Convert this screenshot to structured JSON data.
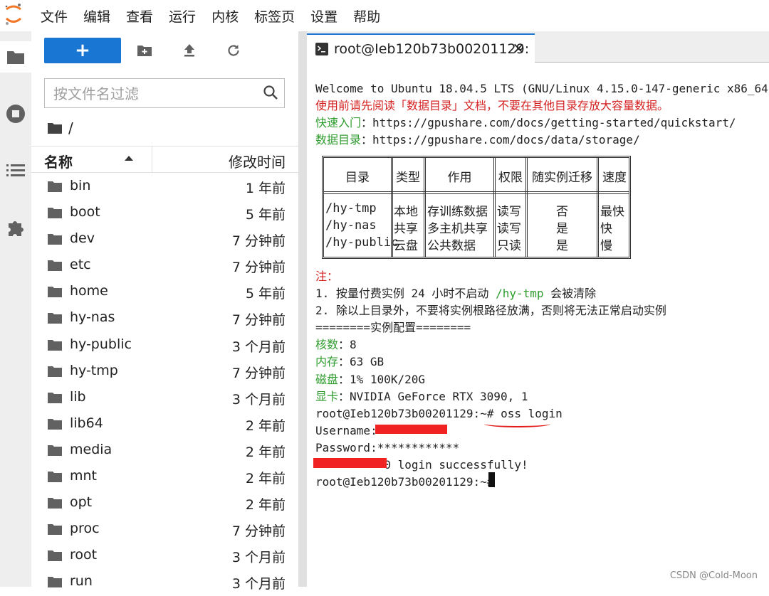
{
  "menu": [
    "文件",
    "编辑",
    "查看",
    "运行",
    "内核",
    "标签页",
    "设置",
    "帮助"
  ],
  "filebrowser": {
    "new_label": "+",
    "filter_placeholder": "按文件名过滤",
    "breadcrumb": "/",
    "col_name": "名称",
    "col_modified": "修改时间",
    "files": [
      {
        "name": "bin",
        "modified": "1 年前"
      },
      {
        "name": "boot",
        "modified": "5 年前"
      },
      {
        "name": "dev",
        "modified": "7 分钟前"
      },
      {
        "name": "etc",
        "modified": "7 分钟前"
      },
      {
        "name": "home",
        "modified": "5 年前"
      },
      {
        "name": "hy-nas",
        "modified": "7 分钟前"
      },
      {
        "name": "hy-public",
        "modified": "3 个月前"
      },
      {
        "name": "hy-tmp",
        "modified": "7 分钟前"
      },
      {
        "name": "lib",
        "modified": "3 个月前"
      },
      {
        "name": "lib64",
        "modified": "2 年前"
      },
      {
        "name": "media",
        "modified": "2 年前"
      },
      {
        "name": "mnt",
        "modified": "2 年前"
      },
      {
        "name": "opt",
        "modified": "2 年前"
      },
      {
        "name": "proc",
        "modified": "7 分钟前"
      },
      {
        "name": "root",
        "modified": "3 个月前"
      },
      {
        "name": "run",
        "modified": "3 个月前"
      }
    ]
  },
  "terminal": {
    "tab_title": "root@Ieb120b73b00201129:",
    "close": "×",
    "welcome": "Welcome to Ubuntu 18.04.5 LTS (GNU/Linux 4.15.0-147-generic x86_64)",
    "notice": "使用前请先阅读「数据目录」文档，不要在其他目录存放大容量数据。",
    "quick_label": "快速入门",
    "quick_url": "：https://gpushare.com/docs/getting-started/quickstart/",
    "data_label": "数据目录",
    "data_url": "：https://gpushare.com/docs/data/storage/",
    "table": {
      "headers": [
        "目录",
        "类型",
        "作用",
        "权限",
        "随实例迁移",
        "速度"
      ],
      "rows": [
        [
          "/hy-tmp",
          "本地",
          "存训练数据",
          "读写",
          "否",
          "最快"
        ],
        [
          "/hy-nas",
          "共享",
          "多主机共享",
          "读写",
          "是",
          "快"
        ],
        [
          "/hy-public",
          "云盘",
          "公共数据",
          "只读",
          "是",
          "慢"
        ]
      ]
    },
    "note_label": "注：",
    "note1_a": "1. 按量付费实例 24 小时不启动 ",
    "note1_path": "/hy-tmp",
    "note1_b": " 会被清除",
    "note2": "2. 除以上目录外，不要将实例根路径放满，否则将无法正常启动实例",
    "config_title": "========实例配置========",
    "cores_label": "核数",
    "cores": "：8",
    "mem_label": "内存",
    "mem": "：63 GB",
    "disk_label": "磁盘",
    "disk": "：1% 100K/20G",
    "gpu_label": "显卡",
    "gpu": "：NVIDIA GeForce RTX 3090, 1",
    "prompt1": "root@Ieb120b73b00201129:~# oss login",
    "username": "Username:",
    "password": "Password:************",
    "login_ok": "          0 login successfully!",
    "prompt2": "root@Ieb120b73b00201129:~# "
  },
  "watermark": "CSDN @Cold-Moon",
  "colors": {
    "accent": "#1976d2",
    "red_text": "#d42222",
    "green_text": "#2e9c2e",
    "redaction": "#f02222"
  }
}
